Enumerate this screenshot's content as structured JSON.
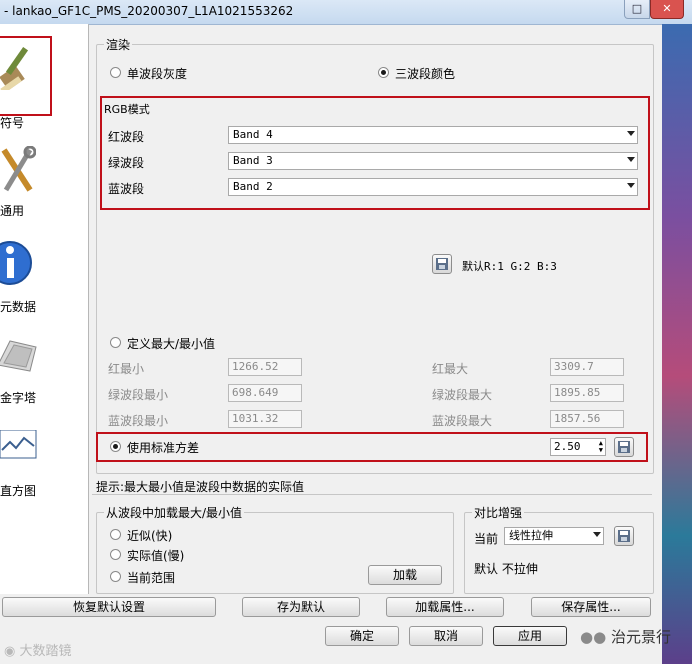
{
  "window": {
    "title": "- lankao_GF1C_PMS_20200307_L1A1021553262"
  },
  "nav": [
    {
      "label": "符号"
    },
    {
      "label": "通用"
    },
    {
      "label": "元数据"
    },
    {
      "label": "金字塔"
    },
    {
      "label": "直方图"
    }
  ],
  "render": {
    "group_title": "渲染",
    "single_band": "单波段灰度",
    "three_band": "三波段颜色"
  },
  "rgb": {
    "title": "RGB模式",
    "red_label": "红波段",
    "red_value": "Band 4",
    "green_label": "绿波段",
    "green_value": "Band 3",
    "blue_label": "蓝波段",
    "blue_value": "Band 2",
    "default_text": "默认R:1 G:2 B:3"
  },
  "minmax": {
    "custom_label": "定义最大/最小值",
    "red_min_label": "红最小",
    "red_min": "1266.52",
    "red_max_label": "红最大",
    "red_max": "3309.7",
    "green_min_label": "绿波段最小",
    "green_min": "698.649",
    "green_max_label": "绿波段最大",
    "green_max": "1895.85",
    "blue_min_label": "蓝波段最小",
    "blue_min": "1031.32",
    "blue_max_label": "蓝波段最大",
    "blue_max": "1857.56",
    "stddev_label": "使用标准方差",
    "stddev_value": "2.50"
  },
  "hint": "提示:最大最小值是波段中数据的实际值",
  "load": {
    "title": "从波段中加载最大/最小值",
    "approx": "近似(快)",
    "actual": "实际值(慢)",
    "extent": "当前范围",
    "load_button": "加载"
  },
  "contrast": {
    "title": "对比增强",
    "current_label": "当前",
    "current_value": "线性拉伸",
    "default_text": "默认 不拉伸"
  },
  "buttons": {
    "restore": "恢复默认设置",
    "save_default": "存为默认",
    "load_style": "加载属性...",
    "save_style": "保存属性...",
    "ok": "确定",
    "cancel": "取消",
    "apply": "应用"
  },
  "watermark": {
    "left": "大数踏镜",
    "right": "治元景行"
  }
}
